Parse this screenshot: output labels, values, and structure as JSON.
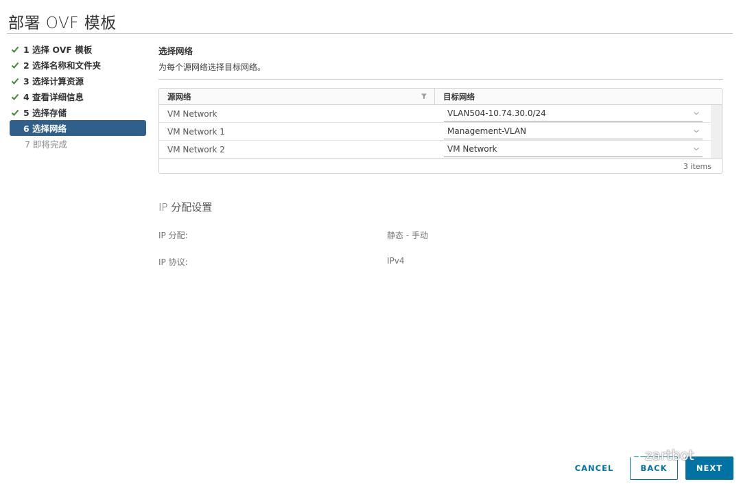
{
  "dialog": {
    "title": "部署 OVF 模板"
  },
  "steps": [
    {
      "label": "1 选择 OVF 模板",
      "state": "done"
    },
    {
      "label": "2 选择名称和文件夹",
      "state": "done"
    },
    {
      "label": "3 选择计算资源",
      "state": "done"
    },
    {
      "label": "4 查看详细信息",
      "state": "done"
    },
    {
      "label": "5 选择存储",
      "state": "done"
    },
    {
      "label": "6 选择网络",
      "state": "active"
    },
    {
      "label": "7 即将完成",
      "state": "future"
    }
  ],
  "main": {
    "title": "选择网络",
    "description": "为每个源网络选择目标网络。",
    "grid": {
      "columns": [
        "源网络",
        "目标网络"
      ],
      "rows": [
        {
          "source": "VM Network",
          "destination": "VLAN504-10.74.30.0/24"
        },
        {
          "source": "VM Network 1",
          "destination": "Management-VLAN"
        },
        {
          "source": "VM Network 2",
          "destination": "VM Network"
        }
      ],
      "footer": "3 items"
    },
    "ip": {
      "title": "IP 分配设置",
      "allocation_label": "IP 分配:",
      "allocation_value": "静态 - 手动",
      "protocol_label": "IP 协议:",
      "protocol_value": "IPv4"
    }
  },
  "buttons": {
    "cancel": "CANCEL",
    "back": "BACK",
    "next": "NEXT"
  },
  "watermark": "zartbot",
  "colors": {
    "accent": "#0072a3",
    "active_step": "#2f5f8b",
    "check": "#3c8a2e"
  },
  "icons": {
    "step_done": "checkmark-icon",
    "filter": "filter-icon",
    "dropdown": "chevron-down-icon"
  }
}
